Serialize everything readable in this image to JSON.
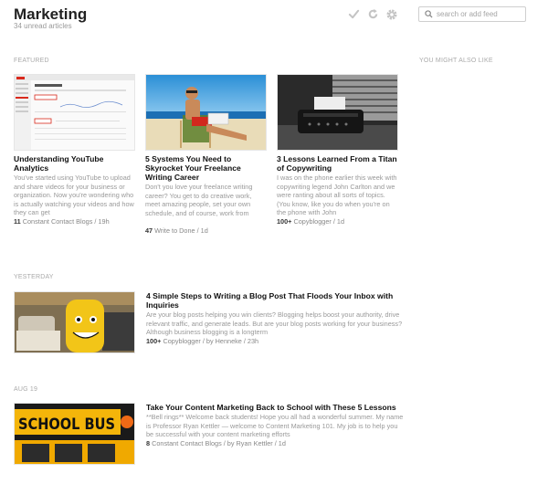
{
  "header": {
    "title": "Marketing",
    "subtitle": "34 unread articles",
    "search_placeholder": "search or add feed"
  },
  "icons": {
    "mark_read": "checkmark-icon",
    "refresh": "refresh-icon",
    "settings": "gear-icon",
    "search": "search-icon"
  },
  "sections": {
    "featured": "FEATURED",
    "related": "YOU MIGHT ALSO LIKE",
    "yesterday": "YESTERDAY",
    "aug19": "AUG 19"
  },
  "featured": [
    {
      "title": "Understanding YouTube Analytics",
      "excerpt": "You've started using YouTube to upload and share videos for your business or organization. Now you're wondering who is actually watching your videos and how they can get",
      "count": "11",
      "source": "Constant Contact Blogs / 19h"
    },
    {
      "title": "5 Systems You Need to Skyrocket Your Freelance Writing Career",
      "excerpt": "Don't you love your freelance writing career? You get to do creative work, meet amazing people, set your own schedule, and of course, work from",
      "count": "47",
      "source": "Write to Done / 1d"
    },
    {
      "title": "3 Lessons Learned From a Titan of Copywriting",
      "excerpt": "I was on the phone earlier this week with copywriting legend John Carlton and we were ranting about all sorts of topics. (You know, like you do when you're on the phone with John",
      "count": "100+",
      "source": "Copyblogger / 1d"
    }
  ],
  "yesterday": [
    {
      "title": "4 Simple Steps to Writing a Blog Post That Floods Your Inbox with Inquiries",
      "excerpt": "Are your blog posts helping you win clients? Blogging helps boost your authority, drive relevant traffic, and generate leads. But are your blog posts working for your business? Although business blogging is a longterm",
      "count": "100+",
      "source": "Copyblogger / by Henneke / 23h"
    }
  ],
  "aug19": [
    {
      "title": "Take Your Content Marketing Back to School with These 5 Lessons",
      "excerpt": "**Bell rings** Welcome back students! Hope you all had a wonderful summer. My name is Professor Ryan Kettler — welcome to Content Marketing 101. My job is to help you be successful with your content marketing efforts",
      "count": "8",
      "source": "Constant Contact Blogs / by Ryan Kettler / 1d"
    }
  ],
  "images": {
    "bus_sign_text": "SCHOOL BUS"
  },
  "colors": {
    "accent_red": "#d9291c",
    "label_gray": "#aaaaaa",
    "title_dark": "#111111"
  }
}
